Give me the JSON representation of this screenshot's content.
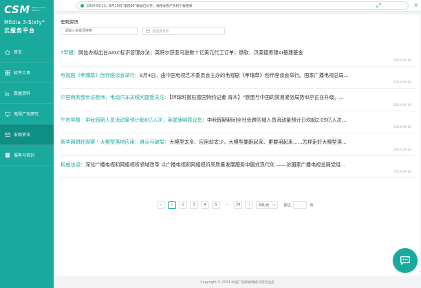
{
  "brand": {
    "logo": "CSM",
    "logo_sub": "Media Service Platform",
    "line1": "MEdia 3-Sixty*",
    "line2": "云服务平台"
  },
  "nav": [
    {
      "label": "首页",
      "icon": "home-icon"
    },
    {
      "label": "软件工具",
      "icon": "grid-icon"
    },
    {
      "label": "数据资料",
      "icon": "chart-icon"
    },
    {
      "label": "电视广告研究",
      "icon": "monitor-icon"
    },
    {
      "label": "宏观资讯",
      "icon": "mail-icon",
      "active": true
    },
    {
      "label": "服务与培训",
      "icon": "book-icon"
    }
  ],
  "notice": {
    "text": "2024-09-12，8月10日“电视30”数据已补齐，请相关客户及时下载更新"
  },
  "main": {
    "title": "宏观资讯",
    "search_placeholder": "请输入关键词搜索",
    "date_placeholder": "请选择月份"
  },
  "news": [
    {
      "tag": "T早报：",
      "title": "网信办拟出台AIGC标识管理办法；英特尔获亚马逊数十亿美元代工订单；微软、贝莱德筹建AI基建基金",
      "date": "2024-09-18"
    },
    {
      "tag": "电视剧《孝瑞草》创作座谈会举行：",
      "title": "9月4日，由中国电视艺术委员会主办的电视剧《孝瑞草》创作座谈会举行。国家广播电视总局...",
      "date": "2024-09-18"
    },
    {
      "tag": "中国商务部长访欧洲，电动汽车关税问题受关注：",
      "title": "【环球时报驻德国特约记者 青木】“欧盟与中国的贸易紧张局势似乎正在升级。...",
      "date": "2024-09-18"
    },
    {
      "tag": "牛市早报｜中秋假期人员流动量预计超6亿人次，美联储明晨议息：",
      "title": "中秋假期期间全社会跨区域人员流动量预计日均超2.05亿人次...",
      "date": "2024-09-18"
    },
    {
      "tag": "新华网财经观察｜大模型落地应用：难点与破局：",
      "title": "大模型太多、应用却太少，大模型要跑起来、更要用起来......怎样走好大模型落...",
      "date": "2024-09-18"
    },
    {
      "tag": "权威访谈：",
      "title": "深化广播电视和网络视听领域改革 以广播电视和网络视听高质量发展服务中国式现代化 ——访国家广播电视总局党组...",
      "date": "2024-09-18"
    }
  ],
  "pagination": {
    "prev": "‹",
    "pages": [
      "1",
      "2",
      "3",
      "4",
      "5"
    ],
    "ellipsis": "···",
    "last": "29",
    "next": "›",
    "page_size": "6条/页",
    "goto_label": "前往",
    "page_unit": "页"
  },
  "footer": "Copyright © 2024 中国广视索福瑞媒介研究出品",
  "colors": {
    "accent": "#1aa99d",
    "accent_dark": "#0f8e83"
  }
}
